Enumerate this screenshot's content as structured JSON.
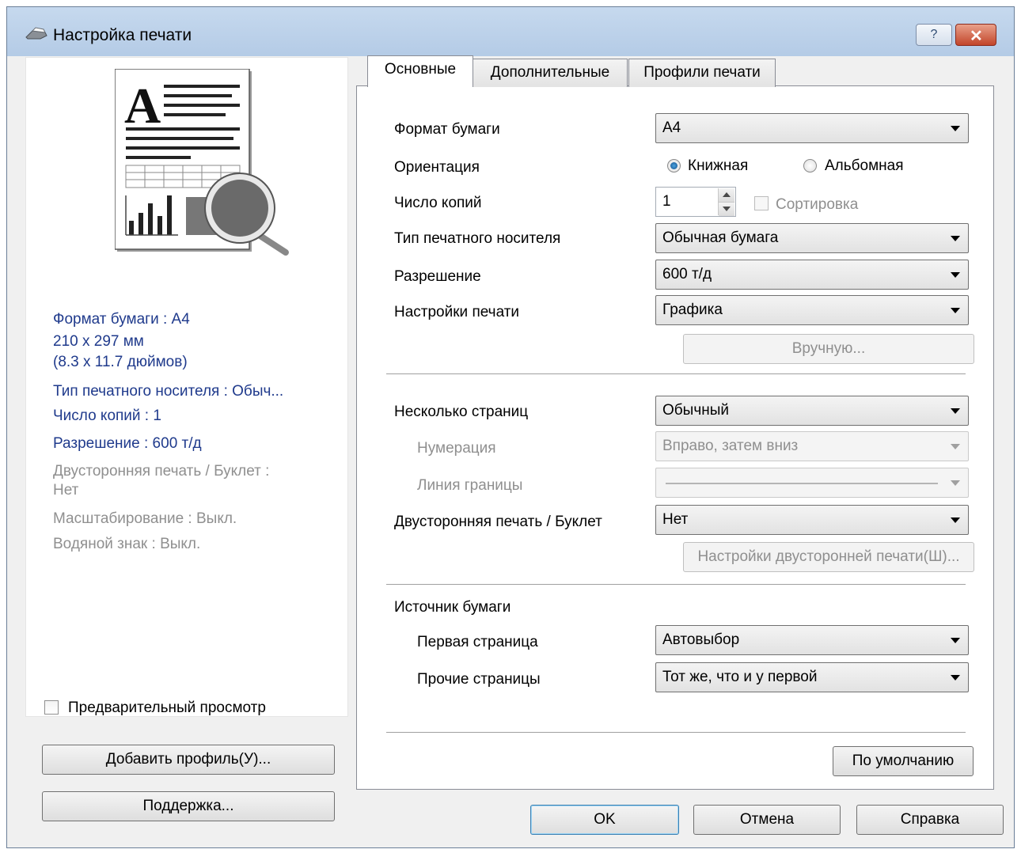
{
  "window": {
    "title": "Настройка печати",
    "help": "?"
  },
  "tabs": [
    "Основные",
    "Дополнительные",
    "Профили печати"
  ],
  "summary": {
    "paper_size": "Формат бумаги : A4",
    "dims_mm": "210 x 297 мм",
    "dims_in": "(8.3 x 11.7 дюймов)",
    "media": "Тип печатного носителя : Обыч...",
    "copies": "Число копий : 1",
    "resolution": "Разрешение : 600 т/д",
    "duplex_1": "Двусторонняя печать / Буклет :",
    "duplex_2": "Нет",
    "scaling": "Масштабирование : Выкл.",
    "watermark": "Водяной знак : Выкл."
  },
  "left": {
    "preview_label": "Предварительный просмотр",
    "add_profile": "Добавить профиль(У)...",
    "support": "Поддержка..."
  },
  "form": {
    "paper_size": {
      "label": "Формат бумаги",
      "value": "A4"
    },
    "orientation": {
      "label": "Ориентация",
      "portrait": "Книжная",
      "landscape": "Альбомная"
    },
    "copies": {
      "label": "Число копий",
      "value": "1",
      "collate": "Сортировка"
    },
    "media": {
      "label": "Тип печатного носителя",
      "value": "Обычная бумага"
    },
    "resolution": {
      "label": "Разрешение",
      "value": "600 т/д"
    },
    "print_settings": {
      "label": "Настройки печати",
      "value": "Графика"
    },
    "manual": "Вручную...",
    "multi_page": {
      "label": "Несколько страниц",
      "value": "Обычный"
    },
    "page_order": {
      "label": "Нумерация",
      "value": "Вправо, затем вниз"
    },
    "border_line": {
      "label": "Линия границы"
    },
    "duplex": {
      "label": "Двусторонняя печать / Буклет",
      "value": "Нет"
    },
    "duplex_settings": "Настройки двусторонней печати(Ш)...",
    "paper_source": {
      "label": "Источник бумаги"
    },
    "first_page": {
      "label": "Первая страница",
      "value": "Автовыбор"
    },
    "other_pages": {
      "label": "Прочие страницы",
      "value": "Тот же, что и у первой"
    },
    "default_btn": "По умолчанию"
  },
  "buttons": {
    "ok": "OK",
    "cancel": "Отмена",
    "help": "Справка"
  }
}
